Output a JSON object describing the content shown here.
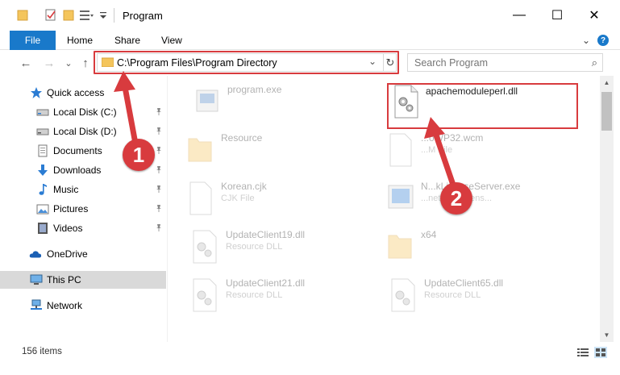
{
  "window": {
    "title": "Program",
    "minimize_glyph": "—",
    "maximize_glyph": "☐",
    "close_glyph": "✕"
  },
  "ribbon": {
    "file": "File",
    "home": "Home",
    "share": "Share",
    "view": "View",
    "expand_glyph": "⌄",
    "help_glyph": "?"
  },
  "nav": {
    "back_glyph": "←",
    "forward_glyph": "→",
    "recent_glyph": "⌄",
    "up_glyph": "↑"
  },
  "address": {
    "path": "C:\\Program Files\\Program Directory",
    "dropdown_glyph": "⌄",
    "refresh_glyph": "↻"
  },
  "search": {
    "placeholder": "Search Program",
    "icon_glyph": "⌕"
  },
  "sidebar": {
    "items": [
      {
        "label": "Quick access",
        "icon": "star-icon",
        "pinned": false
      },
      {
        "label": "Local Disk (C:)",
        "icon": "drive-icon",
        "pinned": true
      },
      {
        "label": "Local Disk (D:)",
        "icon": "drive-icon",
        "pinned": true
      },
      {
        "label": "Documents",
        "icon": "documents-icon",
        "pinned": true
      },
      {
        "label": "Downloads",
        "icon": "downloads-icon",
        "pinned": true
      },
      {
        "label": "Music",
        "icon": "music-icon",
        "pinned": true
      },
      {
        "label": "Pictures",
        "icon": "pictures-icon",
        "pinned": true
      },
      {
        "label": "Videos",
        "icon": "videos-icon",
        "pinned": true
      },
      {
        "label": "OneDrive",
        "icon": "cloud-icon",
        "pinned": false
      },
      {
        "label": "This PC",
        "icon": "pc-icon",
        "pinned": false,
        "selected": true
      },
      {
        "label": "Network",
        "icon": "network-icon",
        "pinned": false
      }
    ],
    "pin_glyph": "📌"
  },
  "files": [
    {
      "name": "program.exe",
      "type": "",
      "icon": "exe-icon",
      "faded": true
    },
    {
      "name": "apachemoduleperl.dll",
      "type": "",
      "icon": "dll-gear-icon",
      "faded": false
    },
    {
      "name": "Resource",
      "type": "",
      "icon": "folder-icon",
      "faded": true
    },
    {
      "name": "...oWP32.wcm",
      "type": "...M File",
      "icon": "file-icon",
      "faded": true
    },
    {
      "name": "Korean.cjk",
      "type": "CJK File",
      "icon": "file-icon",
      "faded": true
    },
    {
      "name": "N...kLicenseServer.exe",
      "type": "...network licens...",
      "icon": "app-icon",
      "faded": true
    },
    {
      "name": "UpdateClient19.dll",
      "type": "Resource DLL",
      "icon": "dll-gear-icon",
      "faded": true
    },
    {
      "name": "x64",
      "type": "",
      "icon": "folder-icon",
      "faded": true
    },
    {
      "name": "UpdateClient21.dll",
      "type": "Resource DLL",
      "icon": "dll-gear-icon",
      "faded": true
    },
    {
      "name": "UpdateClient65.dll",
      "type": "Resource DLL",
      "icon": "dll-gear-icon",
      "faded": true
    }
  ],
  "status": {
    "item_count": "156 items"
  },
  "annotations": {
    "marker_1": "1",
    "marker_2": "2",
    "color": "#d83b3e"
  },
  "colors": {
    "accent": "#1979ca",
    "highlight": "#d83b3e",
    "selected_bg": "#d9d9d9"
  }
}
